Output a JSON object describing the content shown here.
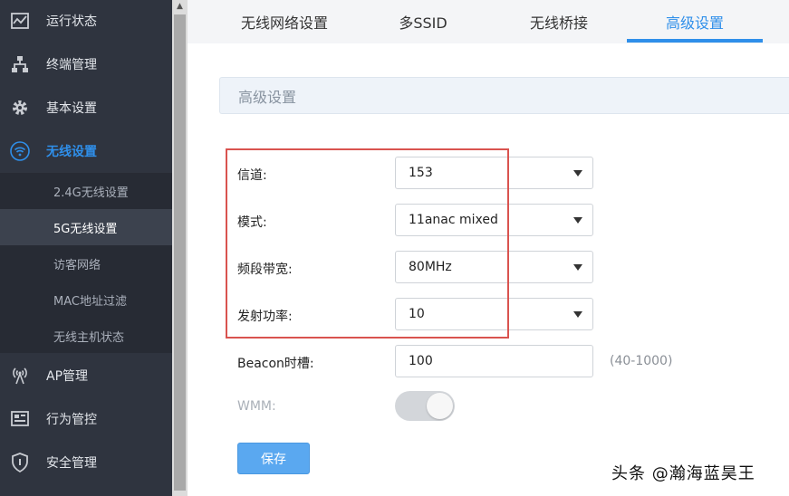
{
  "sidebar": {
    "items": [
      {
        "label": "运行状态",
        "icon": "chart-icon"
      },
      {
        "label": "终端管理",
        "icon": "network-icon"
      },
      {
        "label": "基本设置",
        "icon": "gear-icon"
      },
      {
        "label": "无线设置",
        "icon": "wifi-icon",
        "active": true
      },
      {
        "label": "AP管理",
        "icon": "antenna-icon"
      },
      {
        "label": "行为管控",
        "icon": "monitor-icon"
      },
      {
        "label": "安全管理",
        "icon": "shield-icon"
      }
    ],
    "submenu": [
      {
        "label": "2.4G无线设置"
      },
      {
        "label": "5G无线设置",
        "active": true
      },
      {
        "label": "访客网络"
      },
      {
        "label": "MAC地址过滤"
      },
      {
        "label": "无线主机状态"
      }
    ]
  },
  "tabs": [
    {
      "label": "无线网络设置"
    },
    {
      "label": "多SSID"
    },
    {
      "label": "无线桥接"
    },
    {
      "label": "高级设置",
      "active": true
    }
  ],
  "section": {
    "title": "高级设置"
  },
  "form": {
    "channel": {
      "label": "信道:",
      "value": "153"
    },
    "mode": {
      "label": "模式:",
      "value": "11anac mixed"
    },
    "bandwidth": {
      "label": "频段带宽:",
      "value": "80MHz"
    },
    "tx_power": {
      "label": "发射功率:",
      "value": "10"
    },
    "beacon": {
      "label": "Beacon时槽:",
      "value": "100",
      "hint": "(40-1000)"
    },
    "wmm": {
      "label": "WMM:",
      "enabled": true
    },
    "save_label": "保存"
  },
  "watermark": "头条 @瀚海蓝昊王",
  "colors": {
    "sidebar_bg": "#2f343f",
    "accent": "#2f8fea",
    "highlight": "#d9534f",
    "button": "#5aa8f0"
  }
}
